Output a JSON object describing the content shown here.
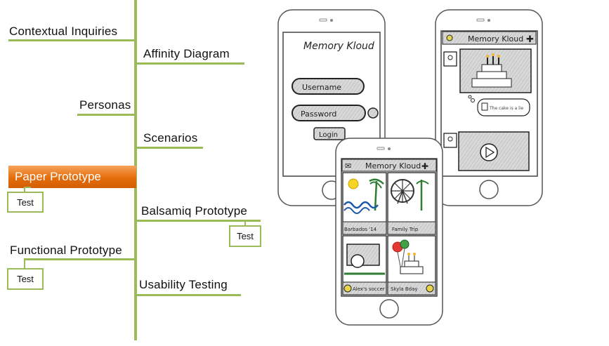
{
  "timeline": {
    "steps": {
      "contextual_inquiries": "Contextual  Inquiries",
      "affinity_diagram": "Affinity Diagram",
      "personas": "Personas",
      "scenarios": "Scenarios",
      "paper_prototype": "Paper Prototype",
      "balsamiq_prototype": "Balsamiq Prototype",
      "functional_prototype": "Functional Prototype",
      "usability_testing": "Usability Testing"
    },
    "test_label": "Test"
  },
  "sketches": {
    "login": {
      "app_title": "Memory Kloud",
      "username": "Username",
      "password": "Password",
      "login_button": "Login"
    },
    "feed": {
      "app_title": "Memory Kloud",
      "comment": "The cake is a lie"
    },
    "gallery": {
      "app_title": "Memory Kloud",
      "captions": [
        "Barbados '14",
        "Family Trip",
        "Alex's soccer",
        "Skyla Bday"
      ]
    }
  },
  "colors": {
    "accent_green": "#9bbb59",
    "highlight_orange": "#e46c0a"
  }
}
